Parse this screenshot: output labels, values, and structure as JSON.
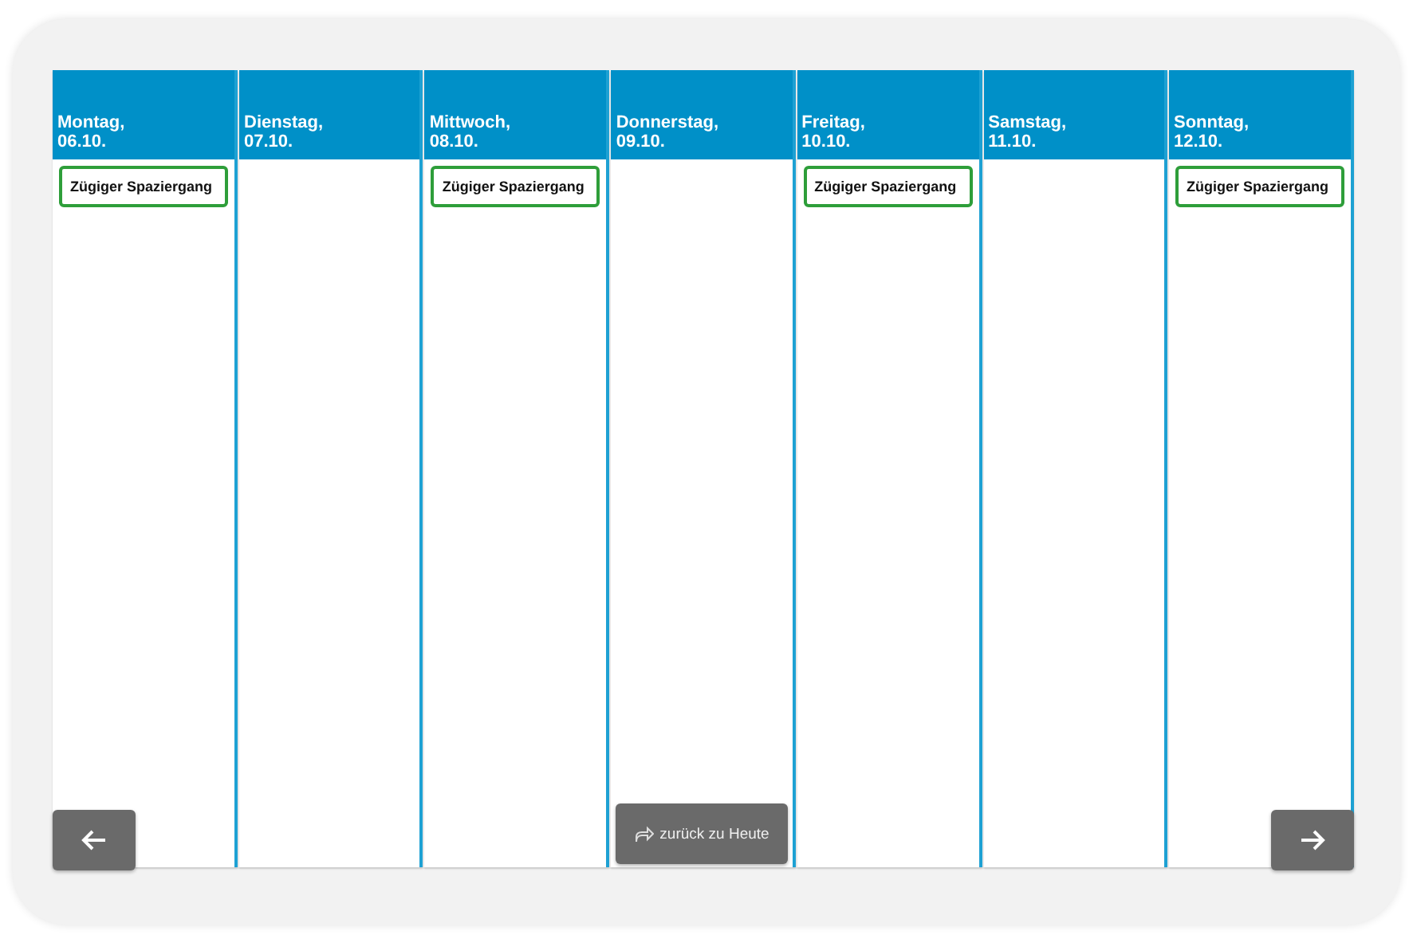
{
  "days": [
    {
      "name": "Montag,",
      "date": "06.10.",
      "events": [
        {
          "title": "Zügiger Spaziergang"
        }
      ]
    },
    {
      "name": "Dienstag,",
      "date": "07.10."
    },
    {
      "name": "Mittwoch,",
      "date": "08.10.",
      "events": [
        {
          "title": "Zügiger Spaziergang"
        }
      ]
    },
    {
      "name": "Donnerstag,",
      "date": "09.10."
    },
    {
      "name": "Freitag,",
      "date": "10.10.",
      "events": [
        {
          "title": "Zügiger Spaziergang"
        }
      ]
    },
    {
      "name": "Samstag,",
      "date": "11.10."
    },
    {
      "name": "Sonntag,",
      "date": "12.10.",
      "events": [
        {
          "title": "Zügiger Spaziergang"
        }
      ]
    }
  ],
  "today_button": {
    "label": "zurück zu Heute"
  }
}
